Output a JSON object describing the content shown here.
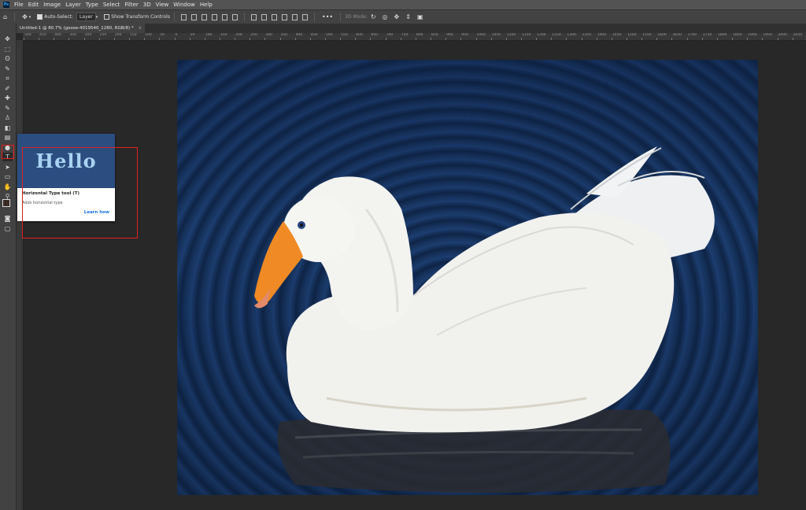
{
  "app": {
    "logo": "Ps"
  },
  "menubar": {
    "items": [
      "File",
      "Edit",
      "Image",
      "Layer",
      "Type",
      "Select",
      "Filter",
      "3D",
      "View",
      "Window",
      "Help"
    ]
  },
  "options": {
    "auto_select_label": "Auto-Select:",
    "auto_select_value": "Layer",
    "transform_controls_label": "Show Transform Controls",
    "mode_3d_label": "3D Mode:"
  },
  "document": {
    "tab_title": "Untitled-1 @ 80.7% (goose-4019540_1280, RGB/8) *",
    "close_glyph": "×"
  },
  "ruler": {
    "ticks": [
      "500",
      "450",
      "400",
      "350",
      "300",
      "250",
      "200",
      "150",
      "100",
      "50",
      "0",
      "50",
      "100",
      "150",
      "200",
      "250",
      "300",
      "350",
      "400",
      "450",
      "500",
      "550",
      "600",
      "650",
      "700",
      "750",
      "800",
      "850",
      "900",
      "950",
      "1000",
      "1050",
      "1100",
      "1150",
      "1200",
      "1250",
      "1300",
      "1350",
      "1400",
      "1450",
      "1500",
      "1550",
      "1600",
      "1650",
      "1700",
      "1750",
      "1800",
      "1850",
      "1900",
      "1950",
      "2000",
      "2050"
    ]
  },
  "tooltip": {
    "preview_text": "Hello",
    "title": "Horizontal Type tool (T)",
    "description": "Adds horizontal type",
    "link": "Learn how"
  },
  "tools": [
    {
      "name": "move-tool",
      "glyph": "✥"
    },
    {
      "name": "marquee-tool",
      "glyph": "⬚"
    },
    {
      "name": "lasso-tool",
      "glyph": "ʘ"
    },
    {
      "name": "quick-select-tool",
      "glyph": "✎"
    },
    {
      "name": "crop-tool",
      "glyph": "⌗"
    },
    {
      "name": "eyedropper-tool",
      "glyph": "✐"
    },
    {
      "name": "healing-brush-tool",
      "glyph": "✚"
    },
    {
      "name": "brush-tool",
      "glyph": "✎"
    },
    {
      "name": "clone-stamp-tool",
      "glyph": "♙"
    },
    {
      "name": "eraser-tool",
      "glyph": "◧"
    },
    {
      "name": "gradient-tool",
      "glyph": "▤"
    },
    {
      "name": "dodge-tool",
      "glyph": "●"
    },
    {
      "name": "type-tool",
      "glyph": "T"
    },
    {
      "name": "path-select-tool",
      "glyph": "➤"
    },
    {
      "name": "rectangle-tool",
      "glyph": "▭"
    },
    {
      "name": "hand-tool",
      "glyph": "✋"
    },
    {
      "name": "zoom-tool",
      "glyph": "⚲"
    },
    {
      "name": "more-tools",
      "glyph": "•••"
    }
  ],
  "colors": {
    "accent": "#1473e6",
    "highlight": "#e02020",
    "tooltip_header": "#2b4d80"
  }
}
